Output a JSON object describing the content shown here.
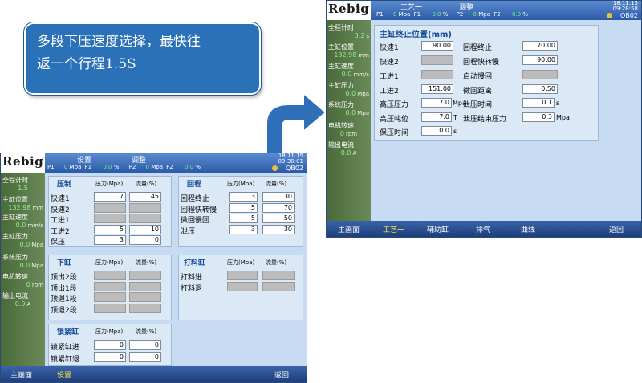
{
  "callout": {
    "line1": "多段下压速度选择，最快往",
    "line2": "返一个行程1.5S"
  },
  "colors": {
    "callout_bg": "#2a71b8",
    "arrow": "#2f6fb8",
    "side_bg": "#5b7a4a",
    "value_green": "#8ef08e",
    "active_nav": "#ffe84a"
  },
  "left_screen": {
    "logo": "Rebig",
    "tabs": [
      "设置",
      "调整"
    ],
    "pressure": {
      "p1": "P1",
      "p1v": "0",
      "p1u": "Mpa",
      "f1": "F1",
      "f1v": "0.0",
      "f1u": "%",
      "p2": "P2",
      "p2v": "0",
      "p2u": "Mpa",
      "f2": "F2",
      "f2v": "0.0",
      "f2u": "%"
    },
    "clock": {
      "date": "18.11.15",
      "time": "09:30:01"
    },
    "code": "QB02",
    "sidebar": [
      {
        "label": "全程计时",
        "value": "1.5",
        "unit": ""
      },
      {
        "label": "主缸位置",
        "value": "132.98",
        "unit": "mm"
      },
      {
        "label": "主缸速度",
        "value": "0.0",
        "unit": "mm/s"
      },
      {
        "label": "主缸压力",
        "value": "0.0",
        "unit": "Mpa"
      },
      {
        "label": "系统压力",
        "value": "0.0",
        "unit": "Mpa"
      },
      {
        "label": "电机转速",
        "value": "0",
        "unit": "rpm"
      },
      {
        "label": "输出电流",
        "value": "0.0",
        "unit": "A"
      }
    ],
    "press": {
      "title": "压制",
      "col_pressure": "压力(Mpa)",
      "col_flow": "流量(%)",
      "rows": [
        {
          "label": "快速1",
          "pressure": "7",
          "flow": "45"
        },
        {
          "label": "快速2",
          "pressure": "",
          "flow": ""
        },
        {
          "label": "工进1",
          "pressure": "",
          "flow": ""
        },
        {
          "label": "工进2",
          "pressure": "5",
          "flow": "10"
        },
        {
          "label": "保压",
          "pressure": "3",
          "flow": "0"
        }
      ]
    },
    "return": {
      "title": "回程",
      "col_pressure": "压力(Mpa)",
      "col_flow": "流量(%)",
      "rows": [
        {
          "label": "回程终止",
          "pressure": "3",
          "flow": "30"
        },
        {
          "label": "回程快转慢",
          "pressure": "5",
          "flow": "70"
        },
        {
          "label": "微回慢回",
          "pressure": "5",
          "flow": "50"
        },
        {
          "label": "泄压",
          "pressure": "3",
          "flow": "30"
        }
      ]
    },
    "lower": {
      "title": "下缸",
      "col_pressure": "压力(Mpa)",
      "col_flow": "流量(%)",
      "rows": [
        {
          "label": "顶出2段"
        },
        {
          "label": "顶出1段"
        },
        {
          "label": "顶退1段"
        },
        {
          "label": "顶退2段"
        }
      ]
    },
    "knock": {
      "title": "打料缸",
      "col_pressure": "压力(Mpa)",
      "col_flow": "流量(%)",
      "rows": [
        {
          "label": "打料进"
        },
        {
          "label": "打料退"
        }
      ]
    },
    "lock": {
      "title": "锁紧缸",
      "col_pressure": "压力(Mpa)",
      "col_flow": "流量(%)",
      "rows": [
        {
          "label": "锁紧缸进",
          "pressure": "0",
          "flow": "0"
        },
        {
          "label": "锁紧缸退",
          "pressure": "0",
          "flow": "0"
        }
      ]
    },
    "footer": {
      "home": "主画面",
      "setting": "设置",
      "back": "返回"
    }
  },
  "right_screen": {
    "logo": "Rebig",
    "tabs": [
      "工艺一",
      "调整"
    ],
    "pressure": {
      "p1": "P1",
      "p1v": "0",
      "p1u": "Mpa",
      "f1": "F1",
      "f1v": "0.0",
      "f1u": "%",
      "p2": "P2",
      "p2v": "0",
      "p2u": "Mpa",
      "f2": "F2",
      "f2v": "0.0",
      "f2u": "%"
    },
    "clock": {
      "date": "18.11.15",
      "time": "09:28:58"
    },
    "code": "QB02",
    "sidebar": [
      {
        "label": "全程计时",
        "value": "3.2",
        "unit": "s"
      },
      {
        "label": "主缸位置",
        "value": "132.98",
        "unit": "mm"
      },
      {
        "label": "主缸速度",
        "value": "0.0",
        "unit": "mm/s"
      },
      {
        "label": "主缸压力",
        "value": "0.0",
        "unit": "Mpa"
      },
      {
        "label": "系统压力",
        "value": "0.0",
        "unit": "Mpa"
      },
      {
        "label": "电机转速",
        "value": "0",
        "unit": "rpm"
      },
      {
        "label": "输出电流",
        "value": "0.0",
        "unit": "A"
      }
    ],
    "params": {
      "title": "主缸终止位置(mm)",
      "left": [
        {
          "label": "快速1",
          "value": "90.00",
          "unit": ""
        },
        {
          "label": "快速2",
          "value": "",
          "unit": ""
        },
        {
          "label": "工进1",
          "value": "",
          "unit": ""
        },
        {
          "label": "工进2",
          "value": "151.00",
          "unit": ""
        },
        {
          "label": "高压压力",
          "value": "7.0",
          "unit": "Mpa"
        },
        {
          "label": "高压吨位",
          "value": "7.0",
          "unit": "T"
        },
        {
          "label": "保压时间",
          "value": "0.0",
          "unit": "s"
        }
      ],
      "right": [
        {
          "label": "回程终止",
          "value": "70.00",
          "unit": ""
        },
        {
          "label": "回程快转慢",
          "value": "90.00",
          "unit": ""
        },
        {
          "label": "启动慢回",
          "value": "",
          "unit": ""
        },
        {
          "label": "微回距离",
          "value": "0.50",
          "unit": ""
        },
        {
          "label": "泄压时间",
          "value": "0.1",
          "unit": "s"
        },
        {
          "label": "泄压结束压力",
          "value": "0.3",
          "unit": "Mpa"
        }
      ]
    },
    "footer": {
      "home": "主画面",
      "process": "工艺一",
      "aux": "辅助缸",
      "exhaust": "排气",
      "curve": "曲线",
      "back": "返回"
    }
  }
}
